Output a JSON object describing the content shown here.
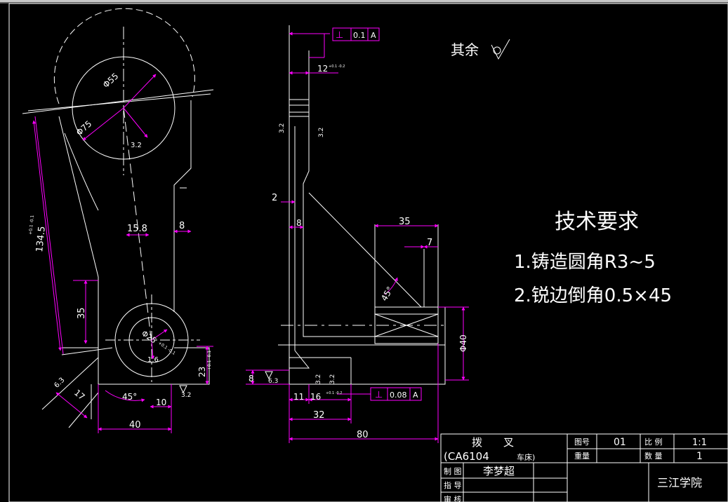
{
  "colors": {
    "background": "#000000",
    "line": "#ffffff",
    "dimension": "#ff00ff",
    "chrome": "#c8c8c8"
  },
  "notes": {
    "surface_finish": "其余",
    "tech_title": "技术要求",
    "tech_1": "1.铸造圆角R3~5",
    "tech_2": "2.锐边倒角0.5×45"
  },
  "dims_left": {
    "d_top_inner": "Φ55",
    "d_top_outer": "Φ75",
    "small_top": "3.2",
    "len_main": "134.5",
    "len_main_tol": "+0.1 -0.1",
    "w_15_8": "15.8",
    "w_8": "8",
    "h_35": "35",
    "d_bottom": "Φ25",
    "d_bottom_tol": "+0.1 -0.1",
    "r_16": "1.6",
    "h_23": "23",
    "h_23_tol": "+0.1 -0.1",
    "ang_45": "45°",
    "w_10": "10",
    "w_40": "40",
    "rough_63": "6.3",
    "len_17": "17",
    "rough_32": "3.2"
  },
  "dims_right": {
    "gdt_top_tol": "0.1",
    "gdt_top_datum": "A",
    "w_12": "12",
    "w_12_tol": "+0.1 -0.2",
    "rough_left": "3.2",
    "rough_right": "3.2",
    "w_2": "2",
    "w_8": "8",
    "w_35": "35",
    "w_7": "7",
    "ang_45": "45°",
    "d_40": "Φ40",
    "h_8": "8",
    "rough_63": "6.3",
    "rough_a": "3.2",
    "rough_b": "3.2",
    "w_11": "11",
    "w_16": "16",
    "w_16_tol": "+0.1 -0.2",
    "gdt_bot_tol": "0.08",
    "gdt_bot_datum": "A",
    "w_32": "32",
    "w_80": "80"
  },
  "title_block": {
    "part_name": "拨　　叉",
    "model": "(CA6104",
    "model_sub": "车床)",
    "lbl_drawing_no": "图号",
    "val_drawing_no": "01",
    "lbl_scale": "比 例",
    "val_scale": "1:1",
    "lbl_weight": "重量",
    "lbl_qty": "数 量",
    "val_qty": "1",
    "lbl_drawn": "制 图",
    "val_drawn": "李梦超",
    "lbl_guide": "指 导",
    "lbl_review": "审 核",
    "school": "三江学院"
  }
}
